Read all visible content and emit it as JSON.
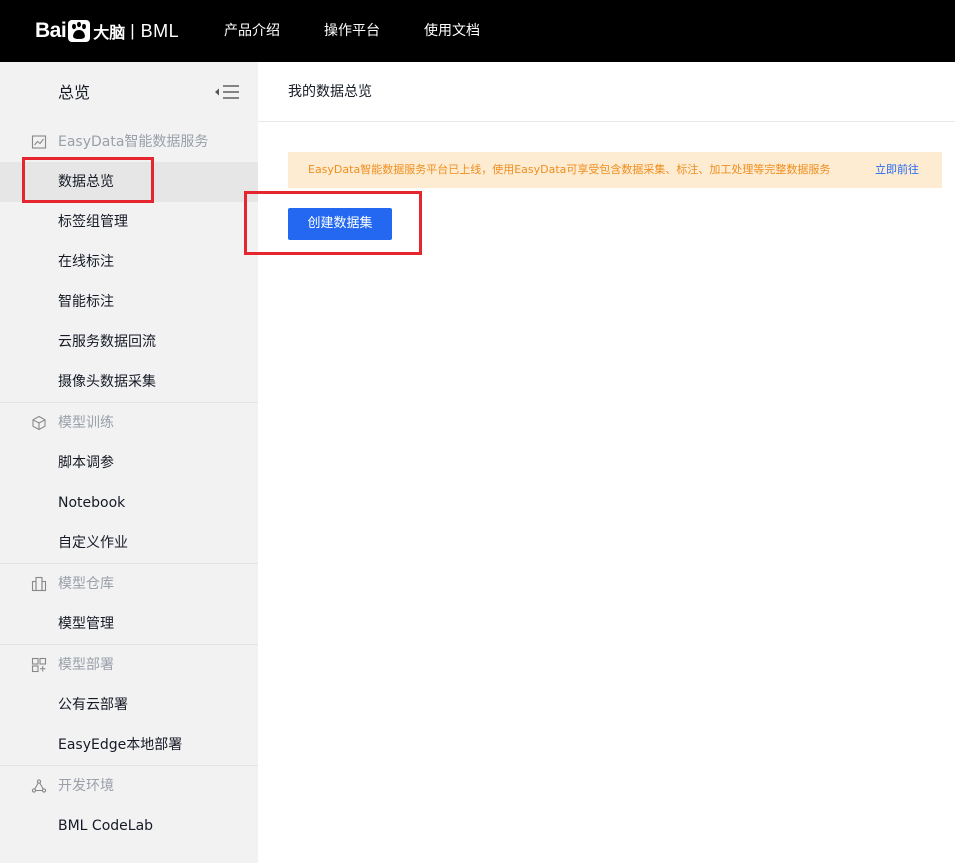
{
  "brand": {
    "bai": "Bai",
    "daonao": "大脑",
    "sep": "|",
    "product": "BML"
  },
  "topnav": [
    "产品介绍",
    "操作平台",
    "使用文档"
  ],
  "sidebar": {
    "title": "总览",
    "groups": [
      {
        "label": "EasyData智能数据服务",
        "icon": "trend-chart-icon",
        "items": [
          {
            "label": "数据总览",
            "active": true
          },
          {
            "label": "标签组管理"
          },
          {
            "label": "在线标注"
          },
          {
            "label": "智能标注"
          },
          {
            "label": "云服务数据回流"
          },
          {
            "label": "摄像头数据采集"
          }
        ]
      },
      {
        "label": "模型训练",
        "icon": "cube-icon",
        "items": [
          {
            "label": "脚本调参"
          },
          {
            "label": "Notebook"
          },
          {
            "label": "自定义作业"
          }
        ]
      },
      {
        "label": "模型仓库",
        "icon": "warehouse-icon",
        "items": [
          {
            "label": "模型管理"
          }
        ]
      },
      {
        "label": "模型部署",
        "icon": "deploy-icon",
        "items": [
          {
            "label": "公有云部署"
          },
          {
            "label": "EasyEdge本地部署"
          }
        ]
      },
      {
        "label": "开发环境",
        "icon": "dev-environment-icon",
        "items": [
          {
            "label": "BML CodeLab"
          }
        ]
      }
    ]
  },
  "main": {
    "title": "我的数据总览",
    "notice": {
      "text": "EasyData智能数据服务平台已上线，使用EasyData可享受包含数据采集、标注、加工处理等完整数据服务",
      "link": "立即前往"
    },
    "create_button": "创建数据集"
  },
  "colors": {
    "topbar": "#000000",
    "sidebar_bg": "#f2f2f2",
    "active_item_bg": "#e6e6e6",
    "primary": "#2468f2",
    "notice_bg": "#fdecd2",
    "notice_text": "#f08e1e",
    "highlight_box": "#e6262e"
  }
}
